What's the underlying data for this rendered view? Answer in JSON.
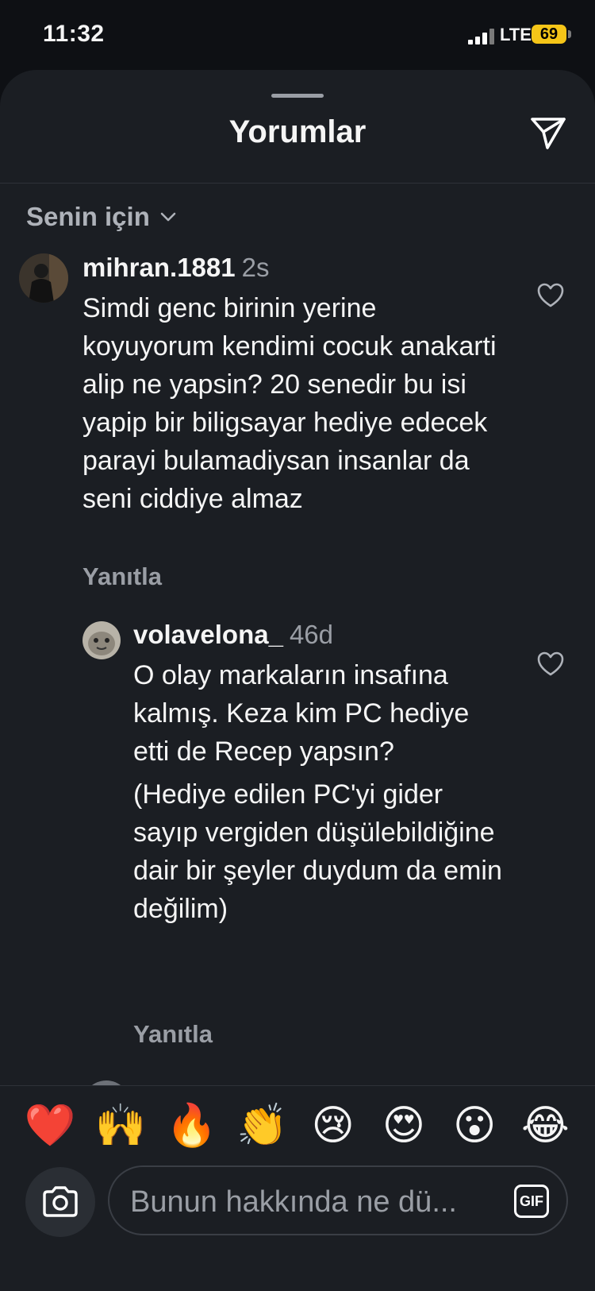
{
  "status_bar": {
    "time": "11:32",
    "network": "LTE",
    "battery": "69"
  },
  "sheet": {
    "title": "Yorumlar",
    "filter_label": "Senin için"
  },
  "comments": [
    {
      "username": "mihran.1881",
      "age": "2s",
      "paragraphs": [
        "Simdi genc birinin yerine koyuyorum kendimi cocuk anakarti alip ne yapsin? 20 senedir bu isi yapip bir biligsayar hediye edecek parayi bulamadiysan insanlar da seni ciddiye almaz"
      ],
      "reply_label": "Yanıtla"
    },
    {
      "username": "volavelona_",
      "age": "46d",
      "paragraphs": [
        "O olay markaların insafına kalmış. Keza kim PC hediye etti de Recep yapsın?",
        "(Hediye edilen PC'yi gider sayıp vergiden düşülebildiğine dair bir şeyler duydum da emin değilim)"
      ],
      "reply_label": "Yanıtla"
    }
  ],
  "emoji_bar": [
    "❤️",
    "🙌",
    "🔥",
    "👏",
    "😢",
    "😍",
    "😮",
    "😂"
  ],
  "composer": {
    "placeholder": "Bunun hakkında ne dü...",
    "gif_label": "GIF"
  },
  "colors": {
    "background": "#1b1e23",
    "muted_text": "#9a9ea5",
    "battery": "#f5c518"
  }
}
